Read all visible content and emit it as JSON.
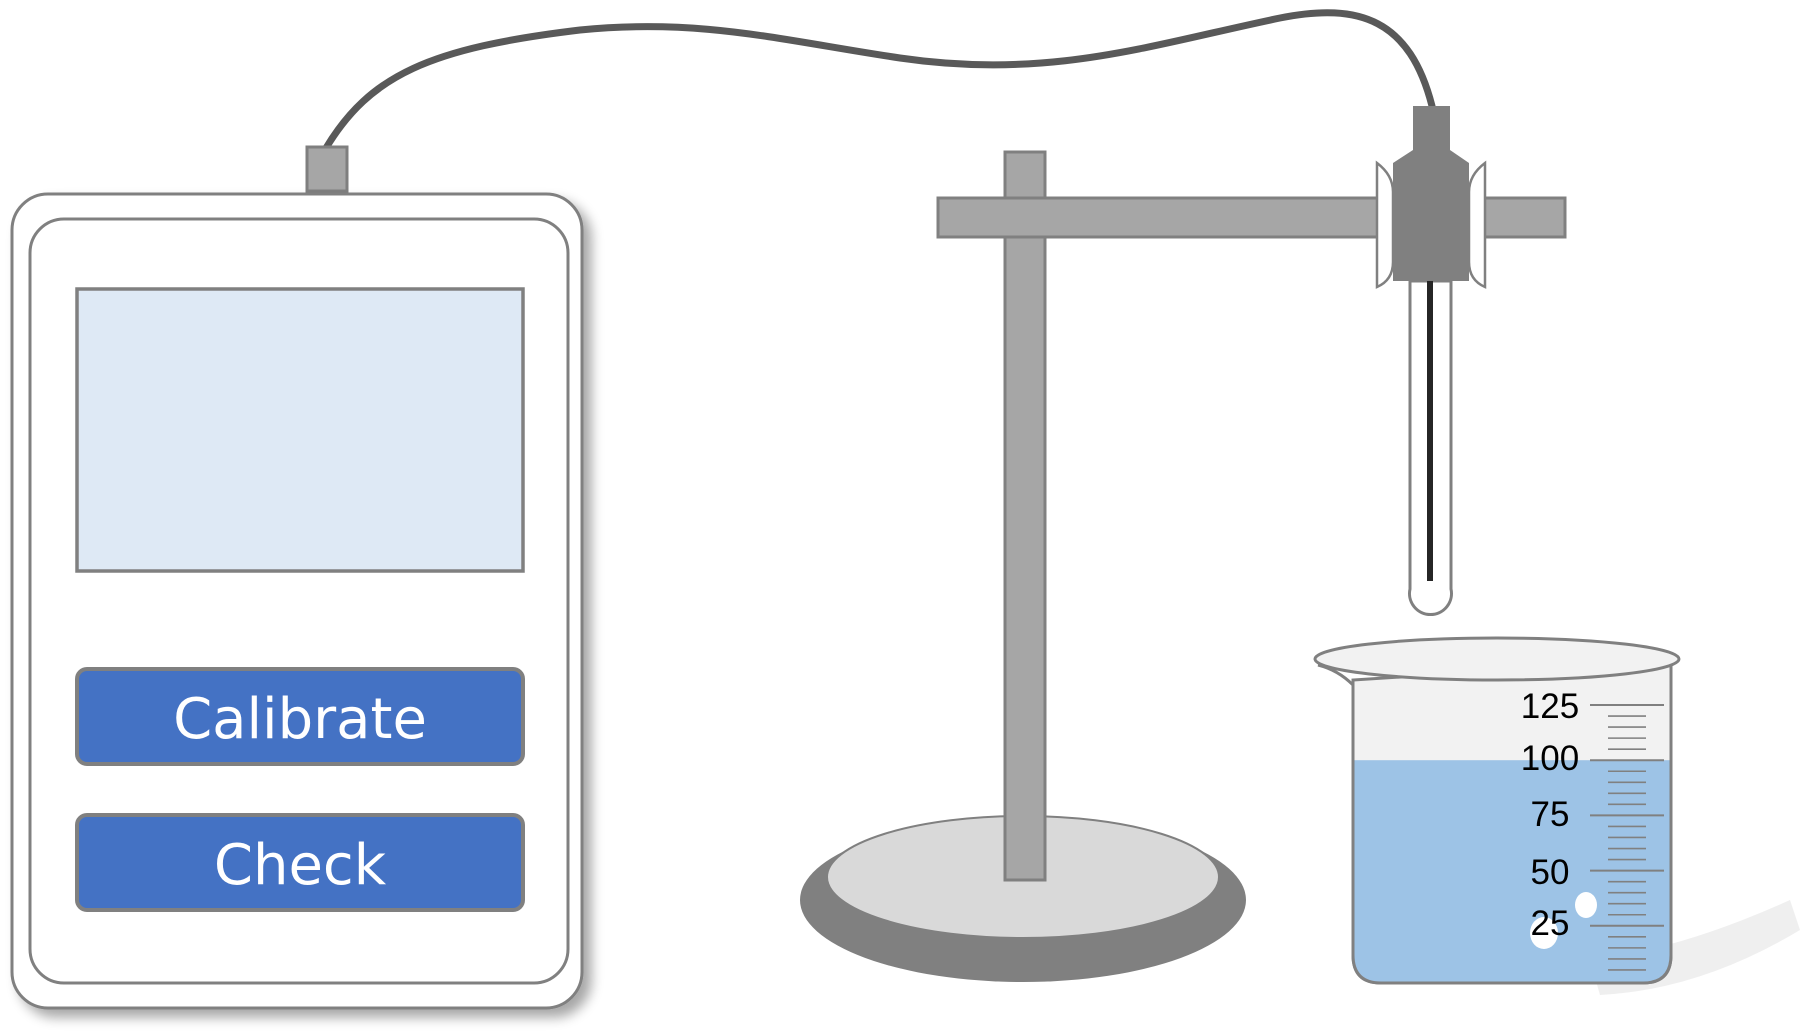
{
  "meter": {
    "display_text": "",
    "buttons": {
      "calibrate_label": "Calibrate",
      "check_label": "Check"
    }
  },
  "beaker": {
    "scale_labels": [
      "125",
      "100",
      "75",
      "50",
      "25"
    ],
    "liquid_level_ml": 100
  },
  "colors": {
    "button_fill": "#4472c4",
    "screen_fill": "#dee9f5",
    "liquid_fill": "#9dc3e6",
    "metal_gray": "#a6a6a6",
    "dark_gray": "#808080",
    "cable": "#595959"
  },
  "icons": [
    "ph-meter-icon",
    "probe-icon",
    "retort-stand-icon",
    "beaker-icon",
    "cable-icon"
  ]
}
